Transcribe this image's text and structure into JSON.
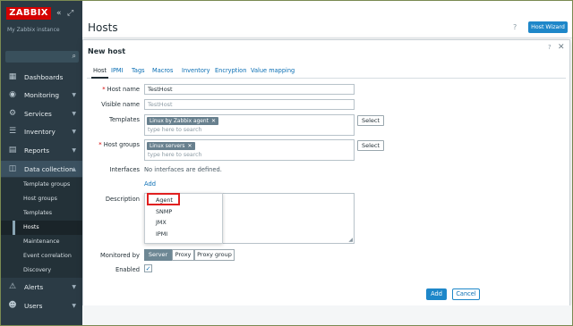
{
  "sidebar": {
    "logo": "ZABBIX",
    "instance": "My Zabbix instance",
    "collapse_glyph": "«",
    "kiosk_glyph": "⤢",
    "items": [
      {
        "label": "Dashboards",
        "icon": "dashboard-icon",
        "glyph": "▦"
      },
      {
        "label": "Monitoring",
        "icon": "monitoring-icon",
        "glyph": "◉"
      },
      {
        "label": "Services",
        "icon": "services-icon",
        "glyph": "⚙"
      },
      {
        "label": "Inventory",
        "icon": "inventory-icon",
        "glyph": "☰"
      },
      {
        "label": "Reports",
        "icon": "reports-icon",
        "glyph": "▤"
      },
      {
        "label": "Data collection",
        "icon": "data-collection-icon",
        "glyph": "◫"
      },
      {
        "label": "Alerts",
        "icon": "alerts-icon",
        "glyph": "🔔"
      },
      {
        "label": "Users",
        "icon": "users-icon",
        "glyph": "👤"
      }
    ],
    "subitems": [
      "Template groups",
      "Host groups",
      "Templates",
      "Hosts",
      "Maintenance",
      "Event correlation",
      "Discovery"
    ]
  },
  "header": {
    "title": "Hosts",
    "help": "?",
    "host_wizard": "Host Wizard"
  },
  "modal": {
    "title": "New host",
    "help": "?",
    "close": "✕",
    "tabs": [
      "Host",
      "IPMI",
      "Tags",
      "Macros",
      "Inventory",
      "Encryption",
      "Value mapping"
    ],
    "fields": {
      "host_name_label": "Host name",
      "host_name_value": "TestHost",
      "visible_name_label": "Visible name",
      "visible_name_placeholder": "TestHost",
      "templates_label": "Templates",
      "templates_chip": "Linux by Zabbix agent",
      "templates_placeholder": "type here to search",
      "host_groups_label": "Host groups",
      "host_groups_chip": "Linux servers",
      "host_groups_placeholder": "type here to search",
      "select_label": "Select",
      "interfaces_label": "Interfaces",
      "interfaces_text": "No interfaces are defined.",
      "add_link": "Add",
      "description_label": "Description",
      "monitored_by_label": "Monitored by",
      "monitored_by_options": [
        "Server",
        "Proxy",
        "Proxy group"
      ],
      "enabled_label": "Enabled",
      "enabled_check": "✓"
    },
    "interface_menu": [
      "Agent",
      "SNMP",
      "JMX",
      "IPMI"
    ],
    "buttons": {
      "add": "Add",
      "cancel": "Cancel"
    }
  }
}
